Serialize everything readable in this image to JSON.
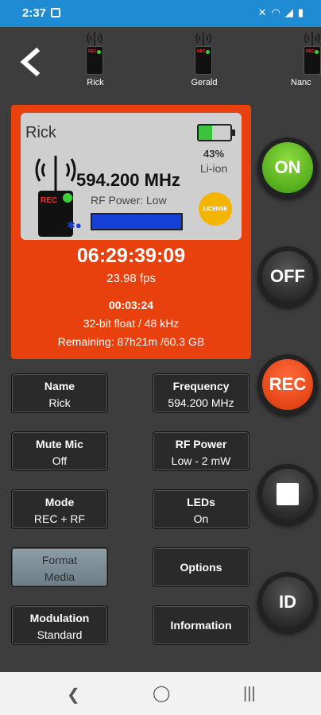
{
  "status_bar": {
    "time": "2:37"
  },
  "devices": [
    {
      "name": "Rick"
    },
    {
      "name": "Gerald"
    },
    {
      "name": "Nanc"
    }
  ],
  "device_led_text": "REC",
  "selected": {
    "name": "Rick",
    "frequency": "594.200 MHz",
    "rf_power_label": "RF Power: Low",
    "rf_power_level": 1.0,
    "battery_percent": "43%",
    "battery_level": 0.43,
    "battery_type": "Li-ion",
    "license_badge": "LICENSE",
    "timecode": "06:29:39:09",
    "fps": "23.98 fps",
    "rec_time": "00:03:24",
    "format": "32-bit float / 48 kHz",
    "remaining": "Remaining: 87h21m /60.3 GB"
  },
  "round_buttons": {
    "on": "ON",
    "off": "OFF",
    "rec": "REC",
    "id": "ID"
  },
  "settings": [
    {
      "title": "Name",
      "value": "Rick"
    },
    {
      "title": "Frequency",
      "value": "594.200 MHz"
    },
    {
      "title": "Mute Mic",
      "value": "Off"
    },
    {
      "title": "RF Power",
      "value": "Low - 2 mW"
    },
    {
      "title": "Mode",
      "value": "REC + RF"
    },
    {
      "title": "LEDs",
      "value": "On"
    },
    {
      "title": "Format",
      "value": "Media"
    },
    {
      "title": "Options",
      "value": ""
    },
    {
      "title": "Modulation",
      "value": "Standard"
    },
    {
      "title": "Information",
      "value": ""
    }
  ],
  "colors": {
    "status_bar": "#1f8bd3",
    "panel": "#e8410d",
    "on_button": "#3a9a0d",
    "rec_button": "#d93608",
    "rf_bar": "#1540d8",
    "battery": "#3cc33c"
  }
}
